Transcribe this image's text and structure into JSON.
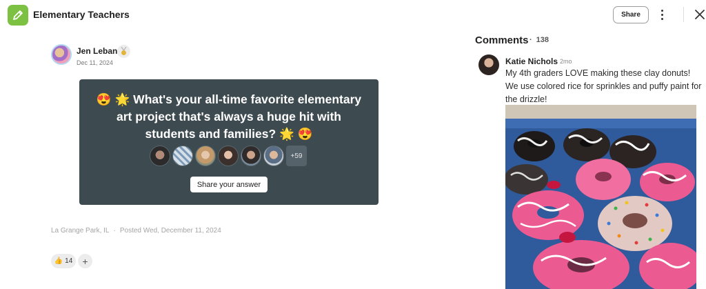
{
  "header": {
    "app_icon": "pencil-icon",
    "title": "Elementary Teachers",
    "share_label": "Share",
    "more_icon": "more-vertical-icon",
    "close_icon": "close-icon"
  },
  "post": {
    "author": {
      "name": "Jen Leban",
      "badge_icon": "medal-icon",
      "date": "Dec 11, 2024"
    },
    "question": {
      "text": "😍 🌟 What's your all-time favorite elementary art project that's always a huge hit with students and families? 🌟 😍",
      "more_answers": "+59",
      "answer_button_label": "Share your answer"
    },
    "location": "La Grange Park, IL",
    "separator": "·",
    "posted": "Posted Wed, December 11, 2024",
    "reaction": {
      "emoji": "👍",
      "count": "14"
    },
    "add_reaction_label": "+"
  },
  "comments": {
    "title": "Comments",
    "separator": "·",
    "count": "138",
    "items": [
      {
        "name": "Katie Nichols",
        "time": "2mo",
        "text": "My 4th graders LOVE making these clay donuts! We use colored rice for sprinkles and puffy paint for the drizzle!"
      }
    ]
  },
  "colors": {
    "app_green": "#7cc142",
    "card_bg": "#3d4a50",
    "photo_tray_blue": "#2f5a9c",
    "donut_pink": "#ec5a92"
  }
}
